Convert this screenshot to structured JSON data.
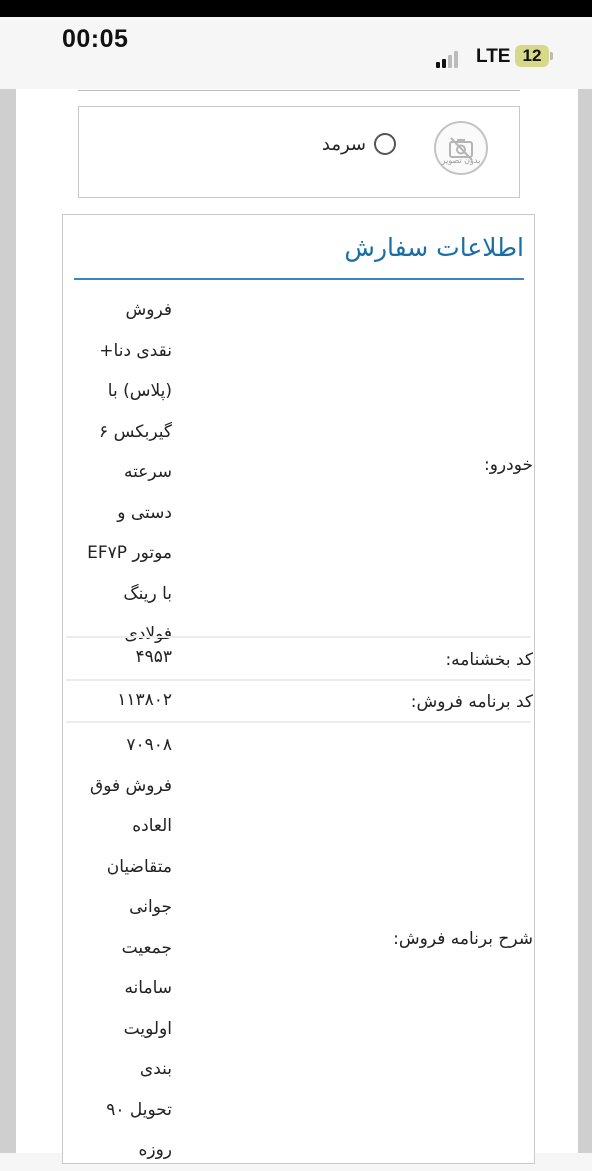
{
  "status_bar": {
    "time": "00:05",
    "network": "LTE",
    "battery": "12"
  },
  "option": {
    "no_image_text": "بدون تصویر",
    "radio_label": "سرمد",
    "radio_selected": false
  },
  "order_info": {
    "title": "اطلاعات سفارش",
    "vehicle": {
      "label": "خودرو:",
      "lines": [
        "فروش",
        "نقدی دنا+",
        "(پلاس) با",
        "گیربکس ۶",
        "سرعته",
        "دستی و",
        "موتور EF۷P",
        "با رینگ",
        "فولادی"
      ]
    },
    "branch_code": {
      "label": "کد بخشنامه:",
      "value": "۴۹۵۳"
    },
    "sale_program_code": {
      "label": "کد برنامه فروش:",
      "value": "۱۱۳۸۰۲"
    },
    "sale_program_desc": {
      "label": "شرح برنامه فروش:",
      "lines": [
        "۷۰۹۰۸",
        "فروش فوق",
        "العاده",
        "متقاضیان",
        "جوانی",
        "جمعیت",
        "سامانه",
        "اولویت",
        "بندی",
        "تحویل ۹۰",
        "روزه"
      ]
    }
  },
  "colors": {
    "accent": "#1a6ea8",
    "accent_line": "#3b86c2"
  }
}
